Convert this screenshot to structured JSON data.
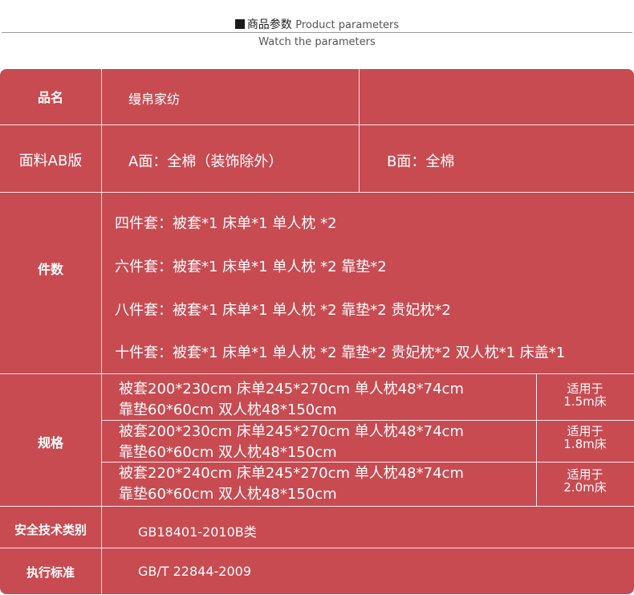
{
  "header": {
    "title_cn": "商品参数",
    "title_en": "Product parameters",
    "subtitle": "Watch the parameters"
  },
  "rows": {
    "brand": {
      "label": "品名",
      "value": "缦帛家纺"
    },
    "fabric": {
      "label": "面料AB版",
      "a_side": "A面：全棉（装饰除外）",
      "b_side": "B面：全棉"
    },
    "pieces": {
      "label": "件数",
      "items": [
        "四件套：被套*1 床单*1 单人枕 *2",
        "六件套：被套*1 床单*1 单人枕 *2 靠垫*2",
        "八件套：被套*1 床单*1 单人枕 *2 靠垫*2 贵妃枕*2",
        "十件套：被套*1 床单*1 单人枕 *2 靠垫*2 贵妃枕*2 双人枕*1 床盖*1"
      ]
    },
    "specs": {
      "label": "规格",
      "items": [
        {
          "line1": "被套200*230cm 床单245*270cm 单人枕48*74cm",
          "line2": "靠垫60*60cm 双人枕48*150cm",
          "fit_label": "适用于",
          "fit_size": "1.5m床"
        },
        {
          "line1": "被套200*230cm 床单245*270cm 单人枕48*74cm",
          "line2": "靠垫60*60cm 双人枕48*150cm",
          "fit_label": "适用于",
          "fit_size": "1.8m床"
        },
        {
          "line1": "被套220*240cm 床单245*270cm 单人枕48*74cm",
          "line2": "靠垫60*60cm 双人枕48*150cm",
          "fit_label": "适用于",
          "fit_size": "2.0m床"
        }
      ]
    },
    "safety": {
      "label": "安全技术类别",
      "value": "GB18401-2010B类"
    },
    "standard": {
      "label": "执行标准",
      "value": "GB/T 22844-2009"
    }
  },
  "colors": {
    "table_bg": "#c84b52",
    "text": "#ffffff"
  }
}
